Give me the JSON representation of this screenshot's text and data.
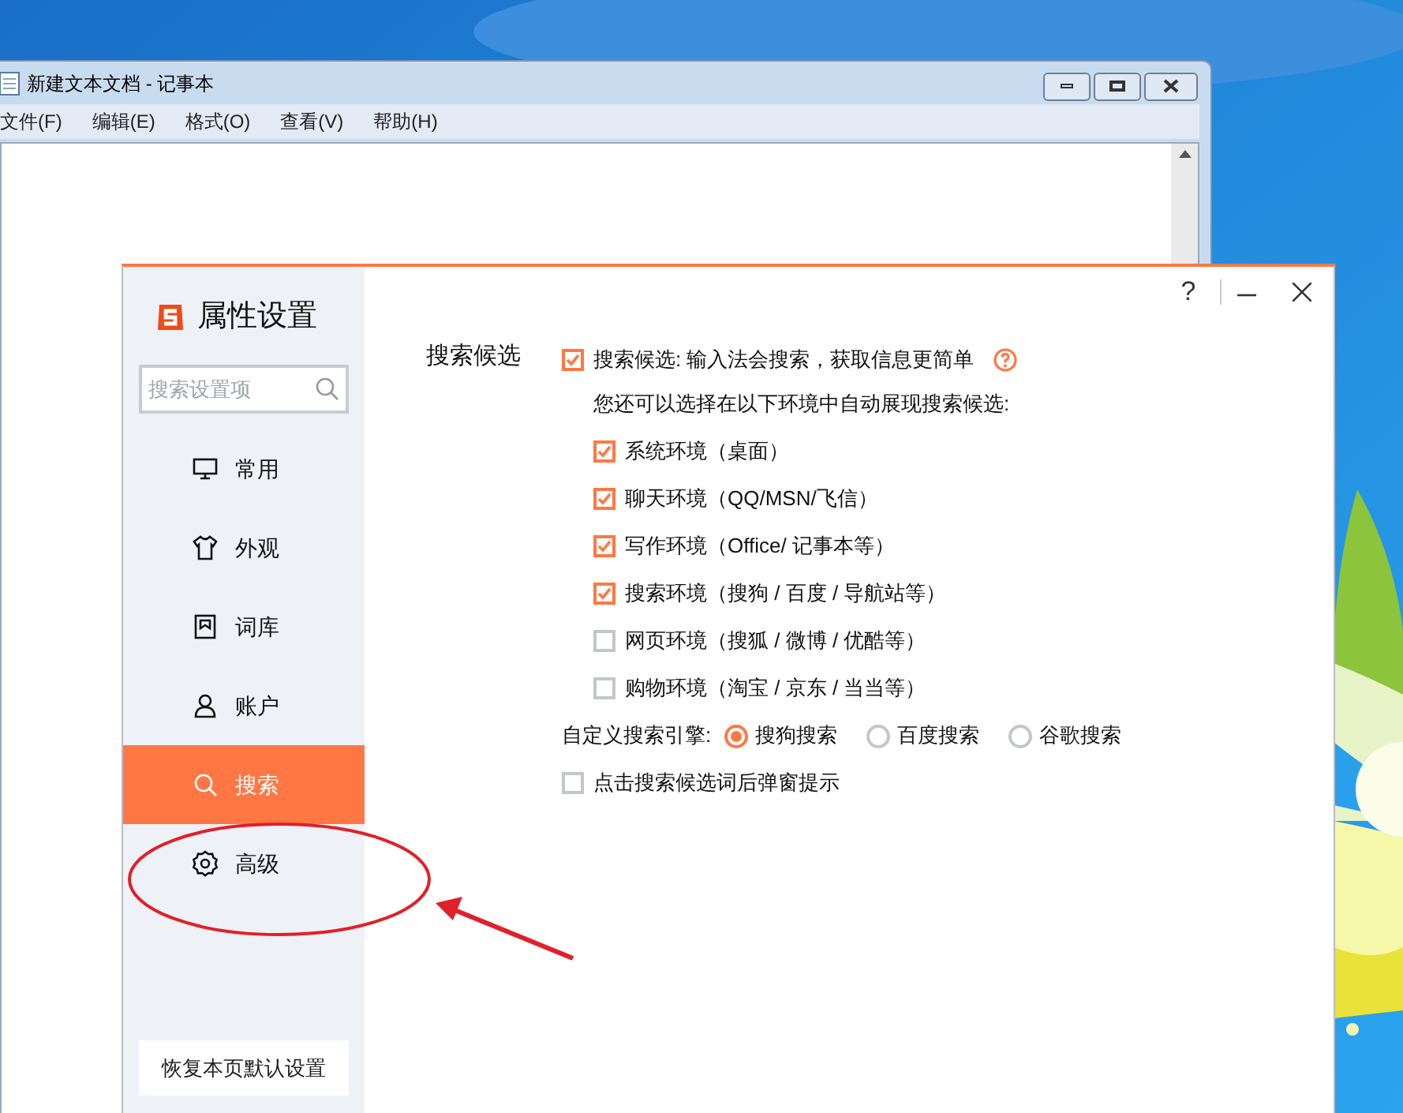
{
  "notepad": {
    "title": "新建文本文档 - 记事本",
    "menu": [
      "文件(F)",
      "编辑(E)",
      "格式(O)",
      "查看(V)",
      "帮助(H)"
    ]
  },
  "dialog": {
    "title": "属性设置",
    "help": "?",
    "search": {
      "placeholder": "搜索设置项"
    },
    "nav": [
      {
        "label": "常用",
        "selected": false
      },
      {
        "label": "外观",
        "selected": false
      },
      {
        "label": "词库",
        "selected": false
      },
      {
        "label": "账户",
        "selected": false
      },
      {
        "label": "搜索",
        "selected": true
      },
      {
        "label": "高级",
        "selected": false
      }
    ],
    "restore_button": "恢复本页默认设置",
    "section_label": "搜索候选",
    "main_option": {
      "label": "搜索候选: 输入法会搜索，获取信息更简单",
      "checked": true
    },
    "hint": "您还可以选择在以下环境中自动展现搜索候选:",
    "environments": [
      {
        "label": "系统环境（桌面）",
        "checked": true
      },
      {
        "label": "聊天环境（QQ/MSN/飞信）",
        "checked": true
      },
      {
        "label": "写作环境（Office/ 记事本等）",
        "checked": true
      },
      {
        "label": "搜索环境（搜狗 / 百度 / 导航站等）",
        "checked": true
      },
      {
        "label": "网页环境（搜狐 / 微博 / 优酷等）",
        "checked": false
      },
      {
        "label": "购物环境（淘宝 / 京东 / 当当等）",
        "checked": false
      }
    ],
    "engine": {
      "label": "自定义搜索引擎:",
      "options": [
        {
          "label": "搜狗搜索",
          "selected": true
        },
        {
          "label": "百度搜索",
          "selected": false
        },
        {
          "label": "谷歌搜索",
          "selected": false
        }
      ]
    },
    "popup_option": {
      "label": "点击搜索候选词后弹窗提示",
      "checked": false
    }
  }
}
